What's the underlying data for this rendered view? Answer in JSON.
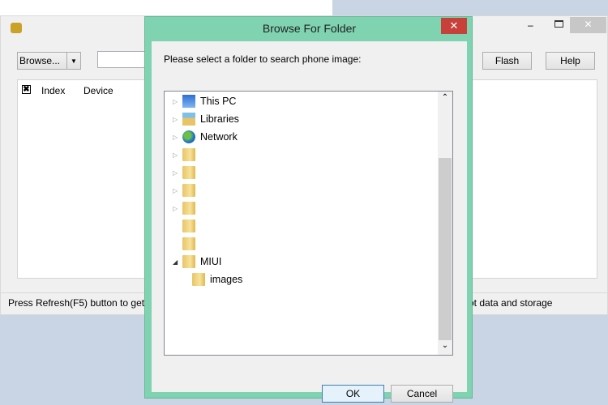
{
  "main": {
    "browse_label": "Browse...",
    "flash_label": "Flash",
    "help_label": "Help",
    "columns": [
      "Index",
      "Device"
    ],
    "status_left": "Press Refresh(F5) button to get t",
    "status_right": "ot data and storage"
  },
  "dialog": {
    "title": "Browse For Folder",
    "prompt": "Please select a folder to search phone image:",
    "ok_label": "OK",
    "cancel_label": "Cancel",
    "tree": [
      {
        "label": "This PC",
        "icon": "computer-icon",
        "expander": "collapsed",
        "level": 0
      },
      {
        "label": "Libraries",
        "icon": "libraries-icon",
        "expander": "collapsed",
        "level": 0
      },
      {
        "label": "Network",
        "icon": "network-icon",
        "expander": "collapsed",
        "level": 0
      },
      {
        "label": "",
        "icon": "folder-icon",
        "expander": "collapsed",
        "level": 0
      },
      {
        "label": "",
        "icon": "folder-icon",
        "expander": "collapsed",
        "level": 0
      },
      {
        "label": "",
        "icon": "folder-icon",
        "expander": "collapsed",
        "level": 0
      },
      {
        "label": "",
        "icon": "folder-icon",
        "expander": "collapsed",
        "level": 0
      },
      {
        "label": "",
        "icon": "folder-icon",
        "expander": "none",
        "level": 0
      },
      {
        "label": "",
        "icon": "folder-icon",
        "expander": "none",
        "level": 0
      },
      {
        "label": "MIUI",
        "icon": "folder-icon",
        "expander": "expanded",
        "level": 0
      },
      {
        "label": "images",
        "icon": "folder-icon",
        "expander": "none",
        "level": 1
      }
    ]
  },
  "colors": {
    "dialog_frame": "#7fd3b1",
    "close_red": "#c7413a"
  }
}
